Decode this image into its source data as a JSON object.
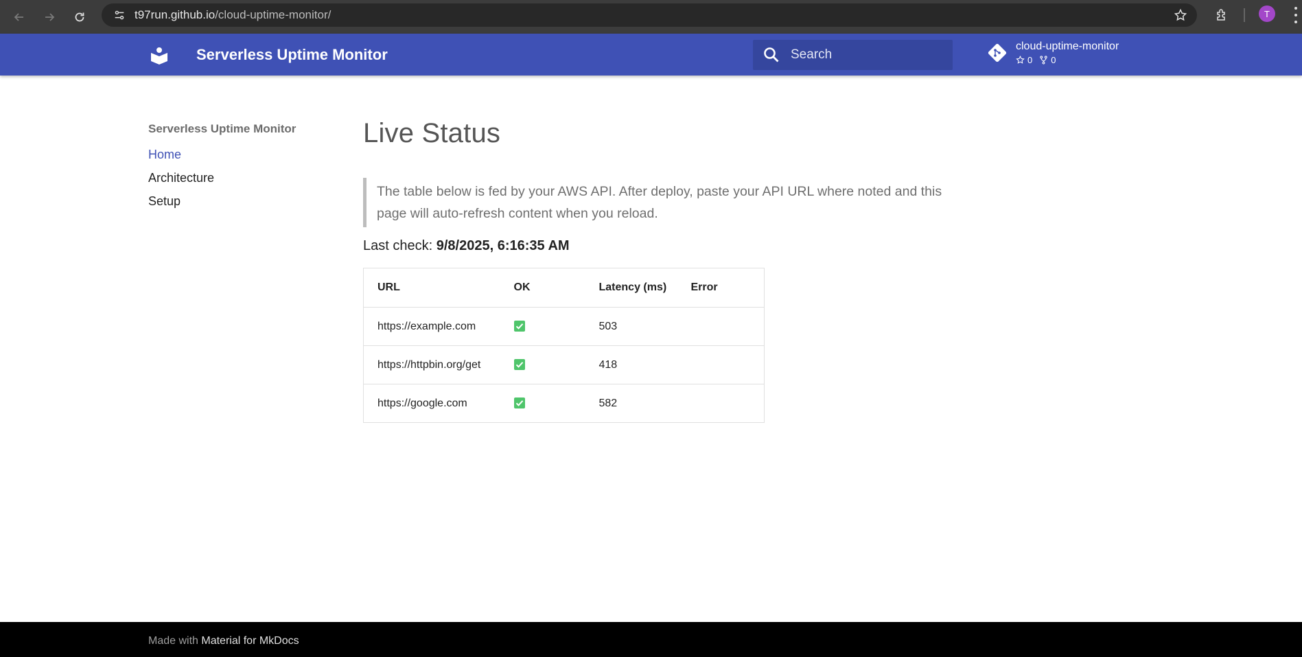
{
  "browser": {
    "url_host": "t97run.github.io",
    "url_path": "/cloud-uptime-monitor/",
    "profile_initial": "T"
  },
  "header": {
    "site_title": "Serverless Uptime Monitor",
    "search_placeholder": "Search",
    "repo_name": "cloud-uptime-monitor",
    "stars": "0",
    "forks": "0"
  },
  "sidebar": {
    "title": "Serverless Uptime Monitor",
    "items": [
      {
        "label": "Home",
        "active": true
      },
      {
        "label": "Architecture",
        "active": false
      },
      {
        "label": "Setup",
        "active": false
      }
    ]
  },
  "main": {
    "title": "Live Status",
    "note": "The table below is fed by your AWS API. After deploy, paste your API URL where noted and this page will auto-refresh content when you reload.",
    "last_check_label": "Last check:",
    "last_check_value": "9/8/2025, 6:16:35 AM",
    "table": {
      "headers": [
        "URL",
        "OK",
        "Latency (ms)",
        "Error"
      ],
      "rows": [
        {
          "url": "https://example.com",
          "ok": true,
          "latency": "503",
          "error": ""
        },
        {
          "url": "https://httpbin.org/get",
          "ok": true,
          "latency": "418",
          "error": ""
        },
        {
          "url": "https://google.com",
          "ok": true,
          "latency": "582",
          "error": ""
        }
      ]
    }
  },
  "footer": {
    "prefix": "Made with",
    "link": "Material for MkDocs"
  },
  "colors": {
    "primary": "#3f51b5",
    "ok_green": "#4fc56b"
  }
}
